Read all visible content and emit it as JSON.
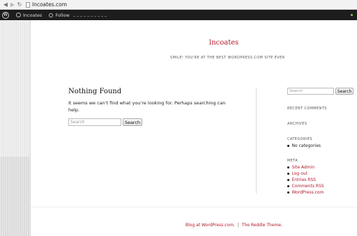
{
  "browser": {
    "back_icon": "back-arrow-icon",
    "forward_icon": "forward-arrow-icon",
    "reload_icon": "reload-icon",
    "url": "lncoates.com"
  },
  "adminbar": {
    "site_name": "lncoates",
    "follow_label": "Follow",
    "status_color": "#7ac142"
  },
  "header": {
    "title": "lncoates",
    "description": "SMILE! YOU'RE AT THE BEST WORDPRESS.COM SITE EVER"
  },
  "main": {
    "title": "Nothing Found",
    "message": "It seems we can't find what you're looking for. Perhaps searching can help.",
    "search_placeholder": "Search",
    "search_button": "Search"
  },
  "sidebar": {
    "search_placeholder": "Search",
    "search_button": "Search",
    "recent_comments_title": "RECENT COMMENTS",
    "archives_title": "ARCHIVES",
    "categories_title": "CATEGORIES",
    "categories": [
      "No categories"
    ],
    "meta_title": "META",
    "meta_links": [
      "Site Admin",
      "Log out",
      "Entries RSS",
      "Comments RSS",
      "WordPress.com"
    ]
  },
  "footer": {
    "blog_at": "Blog at WordPress.com.",
    "separator": "|",
    "theme": "The Reddle Theme."
  },
  "colors": {
    "accent": "#b01a2a",
    "adminbar_bg": "#1d1d1d"
  }
}
